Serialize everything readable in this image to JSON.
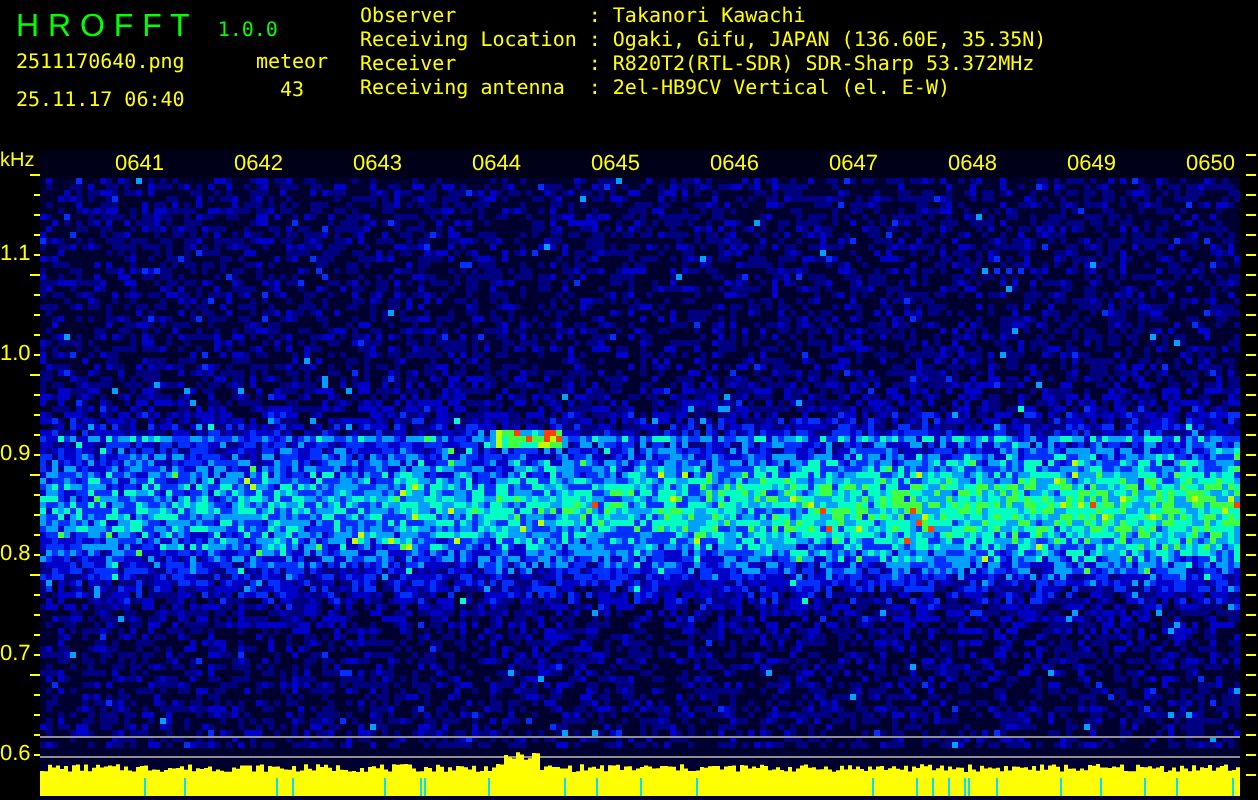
{
  "app": {
    "logo": "H R O F F T",
    "version": "1.0.0",
    "file_name": "2511170640.png",
    "timestamp": "25.11.17 06:40",
    "count_label": "meteor",
    "count": "43"
  },
  "info": [
    {
      "label": "Observer",
      "separator": ":",
      "value": "Takanori Kawachi"
    },
    {
      "label": "Receiving Location",
      "separator": ":",
      "value": "Ogaki, Gifu, JAPAN (136.60E, 35.35N)"
    },
    {
      "label": "Receiver",
      "separator": ":",
      "value": "R820T2(RTL-SDR) SDR-Sharp 53.372MHz"
    },
    {
      "label": "Receiving antenna",
      "separator": ":",
      "value": "2el-HB9CV Vertical (el. E-W)"
    }
  ],
  "frequency_axis": {
    "unit": "kHz",
    "labels": [
      "1.1",
      "1.0",
      "0.9",
      "0.8",
      "0.7",
      "0.6"
    ]
  },
  "time_labels": [
    "0641",
    "0642",
    "0643",
    "0644",
    "0645",
    "0646",
    "0647",
    "0648",
    "0649",
    "0650"
  ]
}
